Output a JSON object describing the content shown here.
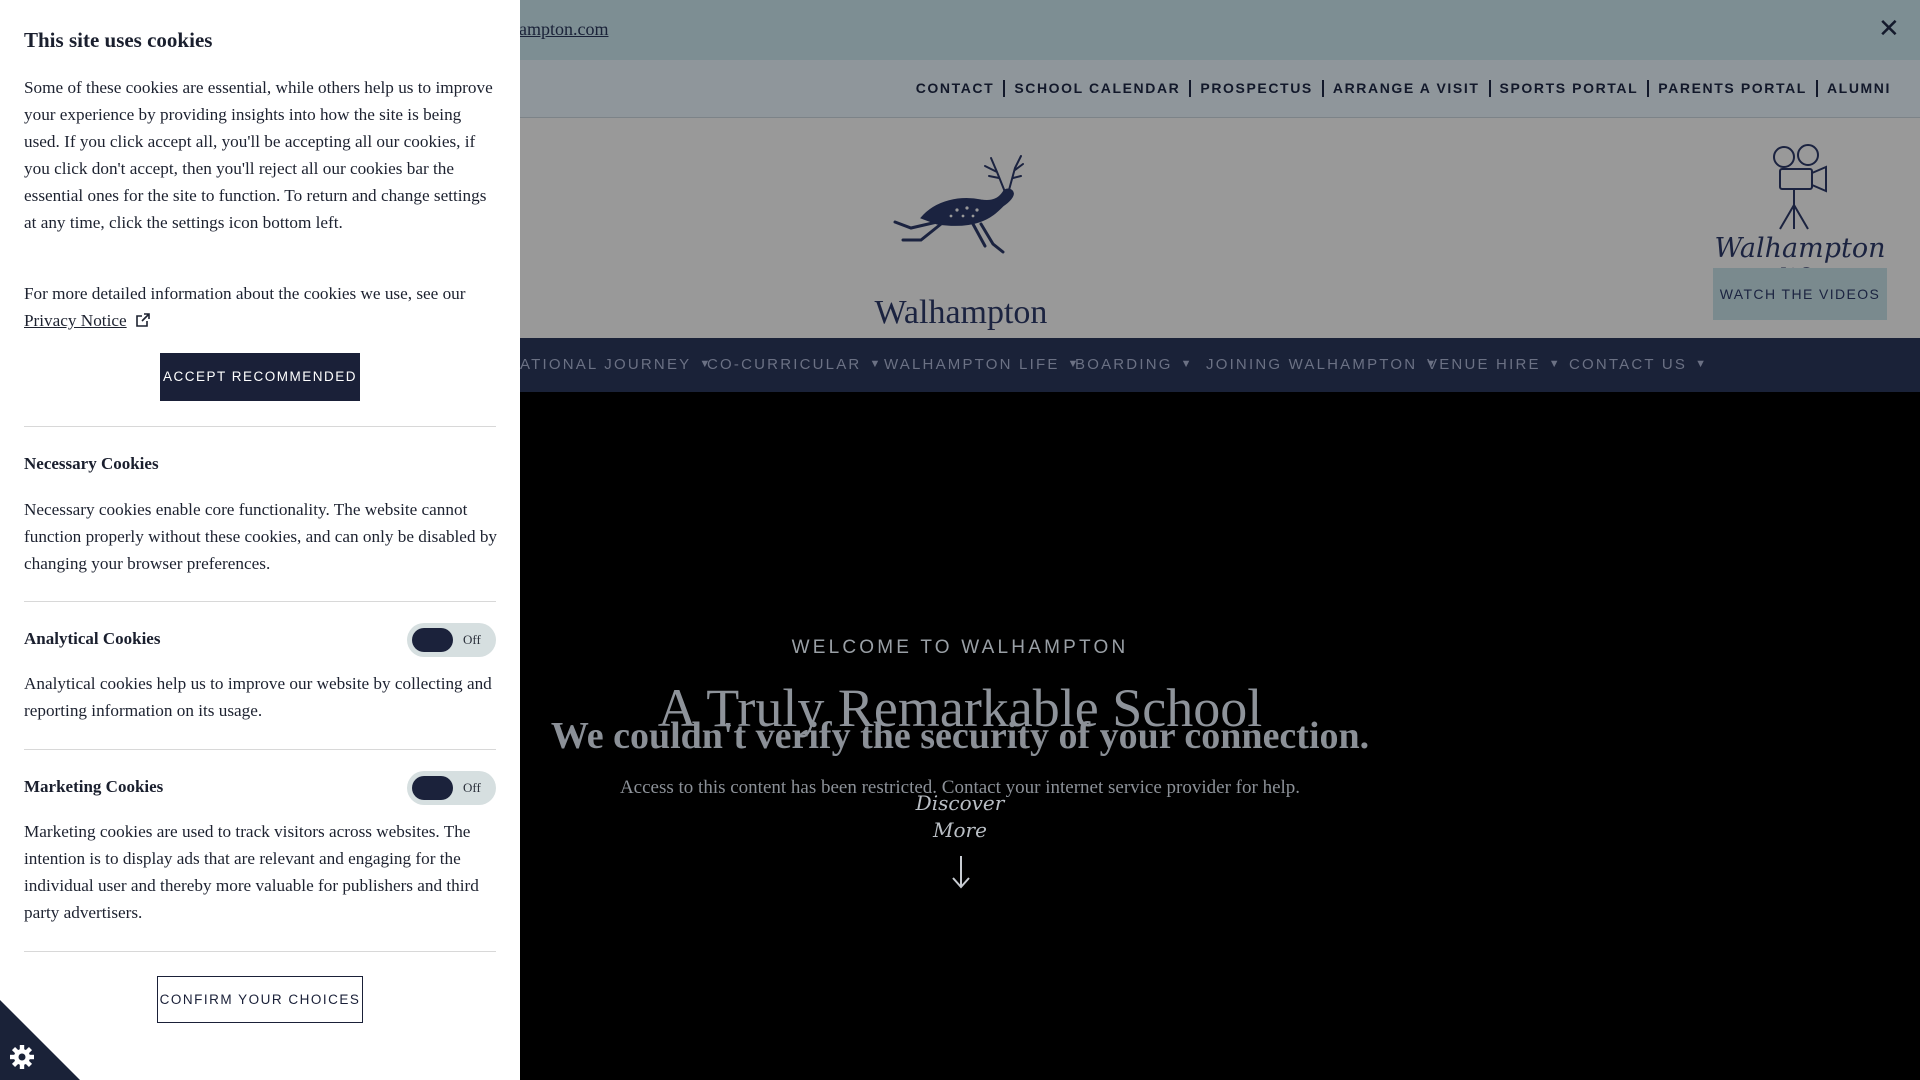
{
  "announcement": {
    "link_text": "ampton.com",
    "close_glyph": "✕"
  },
  "utility_nav": [
    "CONTACT",
    "SCHOOL CALENDAR",
    "PROSPECTUS",
    "ARRANGE A VISIT",
    "SPORTS PORTAL",
    "PARENTS PORTAL",
    "ALUMNI"
  ],
  "brand": {
    "name": "Walhampton",
    "logo_icon": "leaping-stag-icon"
  },
  "walhampton_life": {
    "text": "Walhampton life",
    "icon": "film-camera-icon",
    "button": "WATCH THE VIDEOS"
  },
  "main_nav": [
    "ATIONAL JOURNEY",
    "CO-CURRICULAR",
    "WALHAMPTON LIFE",
    "BOARDING",
    "JOINING WALHAMPTON",
    "VENUE HIRE",
    "CONTACT US"
  ],
  "hero": {
    "kicker": "WELCOME TO WALHAMPTON",
    "title": "A Truly Remarkable School",
    "error_title": "We couldn't verify the security of your connection.",
    "error_message": "Access to this content has been restricted. Contact your internet service provider for help.",
    "discover_line1": "Discover",
    "discover_line2": "More"
  },
  "cookie_panel": {
    "title": "This site uses cookies",
    "intro": "Some of these cookies are essential, while others help us to improve your experience by providing insights into how the site is being used. If you click accept all, you'll be accepting all our cookies, if you click don't accept, then you'll reject all our cookies bar the essential ones for the site to function. To return and change settings at any time, click the settings icon bottom left.",
    "more_info": "For more detailed information about the cookies we use, see our",
    "privacy_link": "Privacy Notice",
    "accept_button": "ACCEPT RECOMMENDED",
    "necessary": {
      "title": "Necessary Cookies",
      "description": "Necessary cookies enable core functionality. The website cannot function properly without these cookies, and can only be disabled by changing your browser preferences."
    },
    "analytical": {
      "title": "Analytical Cookies",
      "toggle": "Off",
      "description": "Analytical cookies help us to improve our website by collecting and reporting information on its usage."
    },
    "marketing": {
      "title": "Marketing Cookies",
      "toggle": "Off",
      "description": "Marketing cookies are used to track visitors across websites. The intention is to display ads that are relevant and engaging for the individual user and thereby more valuable for publishers and third party advertisers."
    },
    "confirm_button": "CONFIRM YOUR CHOICES"
  },
  "colors": {
    "navy": "#1a2238",
    "overlay_grey": "#999999",
    "panel": "#ffffff"
  }
}
